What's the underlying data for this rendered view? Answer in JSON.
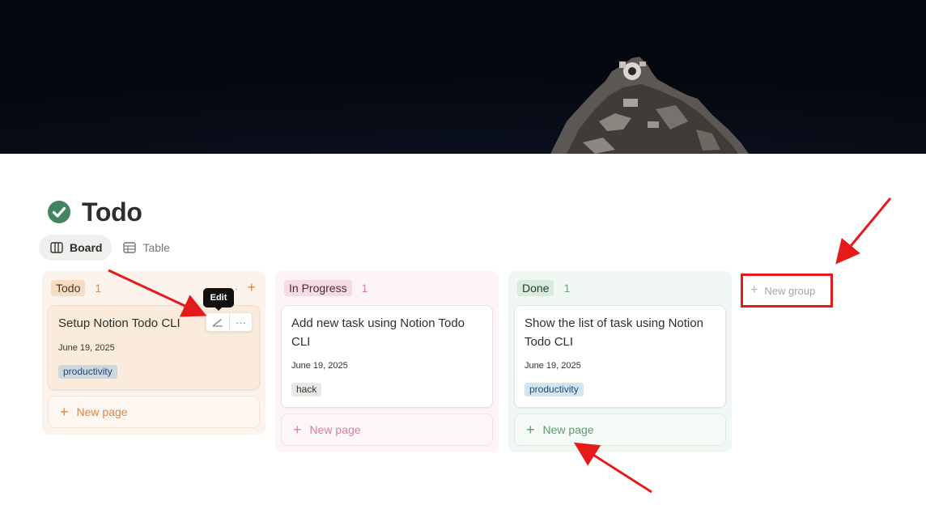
{
  "page": {
    "title": "Todo",
    "icon": "check-circle-icon"
  },
  "views": [
    {
      "label": "Board",
      "icon": "board-icon",
      "active": true
    },
    {
      "label": "Table",
      "icon": "table-icon",
      "active": false
    }
  ],
  "columns": [
    {
      "name": "Todo",
      "count": "1",
      "color": "#d9894b",
      "cards": [
        {
          "title": "Setup Notion Todo CLI",
          "date": "June 19, 2025",
          "tag": "productivity"
        }
      ],
      "new_page_label": "New page"
    },
    {
      "name": "In Progress",
      "count": "1",
      "color": "#d47fa4",
      "cards": [
        {
          "title": "Add new task using Notion Todo CLI",
          "date": "June 19, 2025",
          "tag": "hack"
        }
      ],
      "new_page_label": "New page"
    },
    {
      "name": "Done",
      "count": "1",
      "color": "#6aa57c",
      "cards": [
        {
          "title": "Show the list of task using Notion Todo CLI",
          "date": "June 19, 2025",
          "tag": "productivity"
        }
      ],
      "new_page_label": "New page"
    }
  ],
  "card_actions": {
    "edit_icon": "pencil-icon",
    "more_icon": "more-dots-icon"
  },
  "tooltip": {
    "label": "Edit"
  },
  "new_group": {
    "label": "New group"
  },
  "annotations": {
    "color": "#e51b1b"
  }
}
